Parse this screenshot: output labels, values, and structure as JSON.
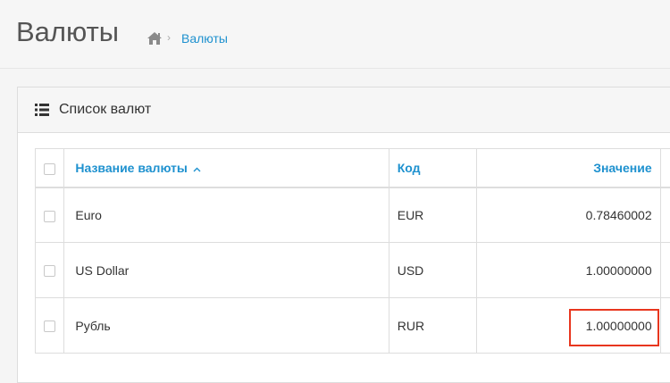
{
  "header": {
    "title": "Валюты",
    "breadcrumb": {
      "home_icon": "home-icon",
      "separator": "›",
      "current": "Валюты"
    }
  },
  "panel": {
    "icon": "list-icon",
    "title": "Список валют"
  },
  "table": {
    "columns": {
      "name": "Название валюты",
      "name_sort_icon": "^",
      "code": "Код",
      "value": "Значение"
    },
    "rows": [
      {
        "name": "Euro",
        "code": "EUR",
        "value": "0.78460002"
      },
      {
        "name": "US Dollar",
        "code": "USD",
        "value": "1.00000000"
      },
      {
        "name": "Рубль",
        "code": "RUR",
        "value": "1.00000000"
      }
    ]
  },
  "colors": {
    "link": "#1e91cf",
    "highlight": "#e8361e"
  }
}
